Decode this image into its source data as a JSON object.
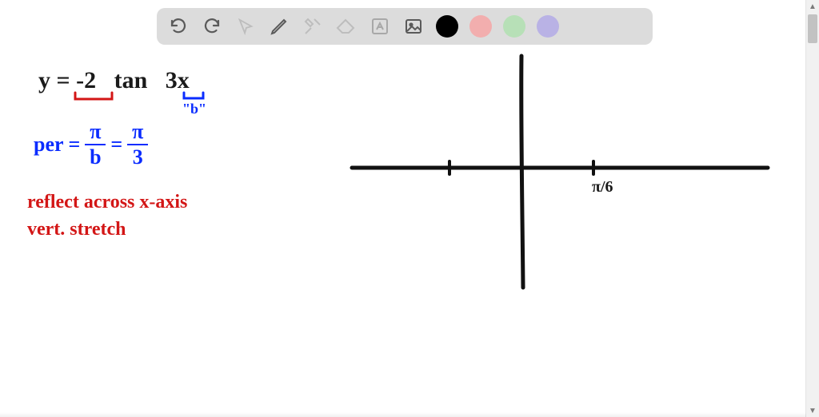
{
  "toolbar": {
    "tools": [
      "undo",
      "redo",
      "pointer",
      "pencil",
      "tools",
      "eraser",
      "text",
      "image"
    ],
    "colors": [
      "#000000",
      "#f2aeae",
      "#b7e0b7",
      "#b9b2e5"
    ],
    "active_color": "#000000"
  },
  "equation": {
    "lhs": "y",
    "eq": "=",
    "coef": "-2",
    "fn": "tan",
    "arg_coef": "3",
    "arg_var": "x",
    "coef_annotation_color": "#d31616",
    "arg_annotation_color": "#0a2cff",
    "b_label": "\"b\""
  },
  "period": {
    "label": "per",
    "eq": "=",
    "num1": "π",
    "den1": "b",
    "eq2": "=",
    "num2": "π",
    "den2": "3"
  },
  "notes": {
    "line1": "reflect across x-axis",
    "line2": "vert. stretch"
  },
  "graph": {
    "x_tick_label": "π/6"
  }
}
